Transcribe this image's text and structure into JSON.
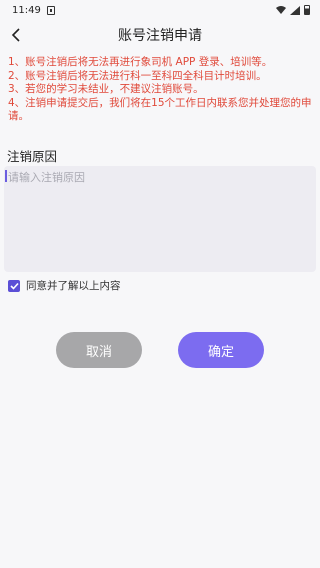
{
  "status_bar": {
    "time": "11:49"
  },
  "header": {
    "title": "账号注销申请"
  },
  "notice": {
    "color": "#e0493a",
    "lines": [
      "1、账号注销后将无法再进行象司机 APP 登录、培训等。",
      "2、账号注销后将无法进行科一至科四全科目计时培训。",
      "3、若您的学习未结业，不建议注销账号。",
      "4、注销申请提交后，我们将在15个工作日内联系您并处理您的申请。"
    ]
  },
  "reason": {
    "label": "注销原因",
    "placeholder": "请输入注销原因",
    "value": ""
  },
  "agreement": {
    "checked": true,
    "label": "同意并了解以上内容"
  },
  "buttons": {
    "cancel_label": "取消",
    "confirm_label": "确定",
    "cancel_color": "#a7a7a9",
    "confirm_color": "#7c6cf0"
  }
}
